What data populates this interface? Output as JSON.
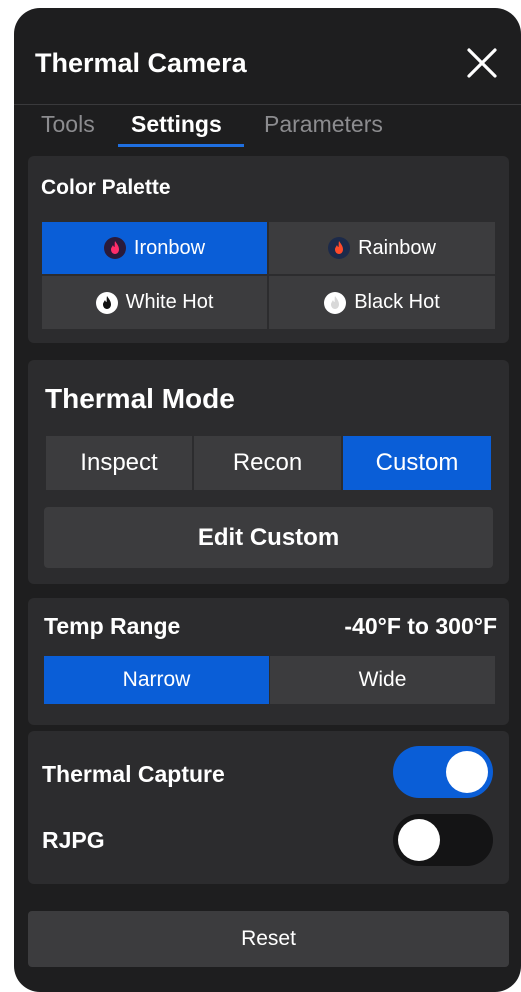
{
  "header": {
    "title": "Thermal Camera",
    "close_icon": "close-icon"
  },
  "tabs": [
    {
      "label": "Tools",
      "active": false
    },
    {
      "label": "Settings",
      "active": true
    },
    {
      "label": "Parameters",
      "active": false
    }
  ],
  "color_palette": {
    "label": "Color Palette",
    "selected": "Ironbow",
    "options": [
      {
        "label": "Ironbow",
        "icon": "ironbow-flame-icon"
      },
      {
        "label": "Rainbow",
        "icon": "rainbow-flame-icon"
      },
      {
        "label": "White Hot",
        "icon": "white-hot-flame-icon"
      },
      {
        "label": "Black Hot",
        "icon": "black-hot-flame-icon"
      }
    ]
  },
  "thermal_mode": {
    "label": "Thermal Mode",
    "selected": "Custom",
    "options": [
      "Inspect",
      "Recon",
      "Custom"
    ],
    "edit_label": "Edit Custom"
  },
  "temp_range": {
    "label": "Temp Range",
    "value": "-40°F to 300°F",
    "selected": "Narrow",
    "options": [
      "Narrow",
      "Wide"
    ]
  },
  "capture": {
    "thermal_capture_label": "Thermal Capture",
    "thermal_capture_on": true,
    "rjpg_label": "RJPG",
    "rjpg_on": false
  },
  "reset_label": "Reset",
  "colors": {
    "accent": "#0a5ed7",
    "panel": "#1e1e1f",
    "card": "#2c2c2e",
    "button": "#3c3c3e"
  }
}
